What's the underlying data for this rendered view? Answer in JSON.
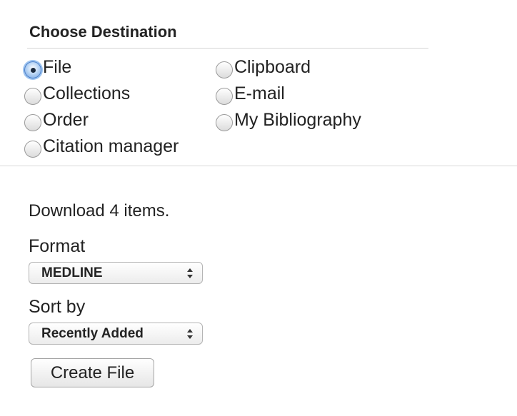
{
  "destination": {
    "heading": "Choose Destination",
    "options": [
      {
        "label": "File",
        "checked": true
      },
      {
        "label": "Clipboard",
        "checked": false
      },
      {
        "label": "Collections",
        "checked": false
      },
      {
        "label": "E-mail",
        "checked": false
      },
      {
        "label": "Order",
        "checked": false
      },
      {
        "label": "My Bibliography",
        "checked": false
      },
      {
        "label": "Citation manager",
        "checked": false
      }
    ]
  },
  "file_panel": {
    "download_text": "Download 4 items.",
    "format": {
      "label": "Format",
      "selected": "MEDLINE"
    },
    "sort": {
      "label": "Sort by",
      "selected": "Recently Added"
    },
    "create_button": "Create File"
  },
  "icons": {
    "select_arrows": "updown-arrows-icon",
    "radio": "radio-button-icon"
  },
  "colors": {
    "accent": "#4a7fc9",
    "text": "#222222",
    "rule": "#d6d6d6"
  }
}
